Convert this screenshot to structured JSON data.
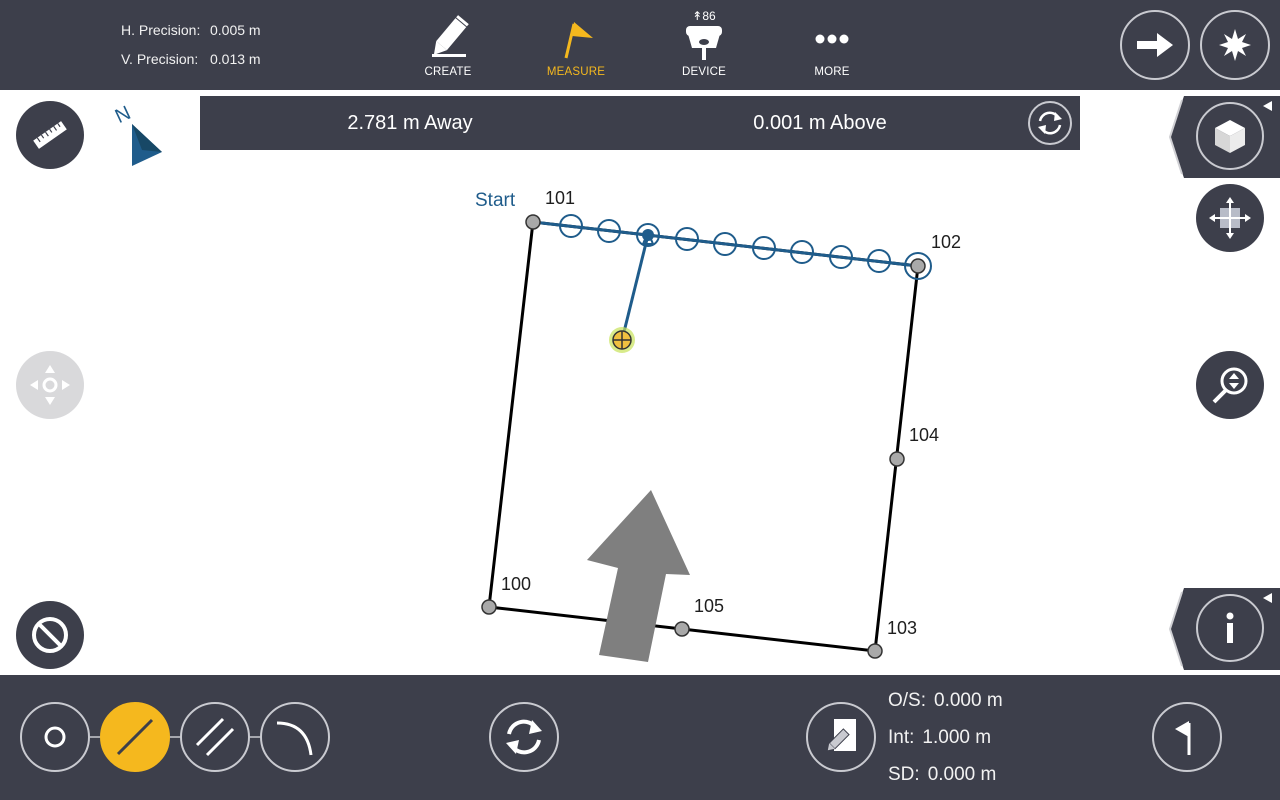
{
  "precision": {
    "h_label": "H. Precision:",
    "h_value": "0.005 m",
    "v_label": "V. Precision:",
    "v_value": "0.013 m"
  },
  "tabs": {
    "create": "CREATE",
    "measure": "MEASURE",
    "device": "DEVICE",
    "device_count": "86",
    "more": "MORE"
  },
  "icons": {
    "next": "arrow-right-icon",
    "star": "starburst-icon",
    "measure_tool": "ruler-icon",
    "north": "north-arrow-icon",
    "pan": "pan-icon",
    "cancel": "cancel-icon",
    "view3d": "cube-icon",
    "move": "move-icon",
    "zoom": "zoom-icon",
    "info": "info-icon"
  },
  "navigation": {
    "away": "2.781 m Away",
    "above": "0.001 m Above"
  },
  "map": {
    "north": "N",
    "start": "Start",
    "points": [
      "100",
      "101",
      "102",
      "103",
      "104",
      "105"
    ]
  },
  "stakeout": {
    "os_label": "O/S:",
    "os_value": "0.000 m",
    "int_label": "Int:",
    "int_value": "1.000 m",
    "sd_label": "SD:",
    "sd_value": "0.000 m"
  },
  "colors": {
    "bar": "#3d3f4b",
    "accent": "#f5b81e",
    "line_blue": "#1f5c8b"
  }
}
